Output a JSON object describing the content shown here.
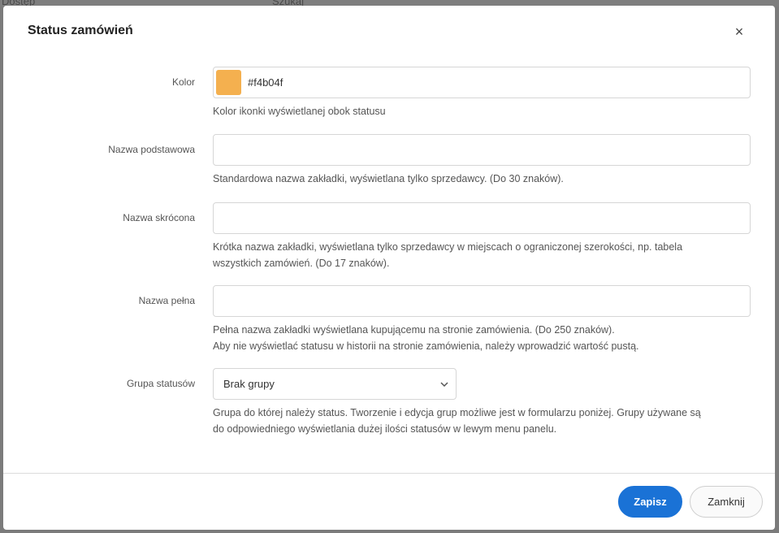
{
  "background": {
    "left_text": "Dostęp",
    "search_placeholder": "Szukaj"
  },
  "modal": {
    "title": "Status zamówień",
    "close_label": "×"
  },
  "form": {
    "color": {
      "label": "Kolor",
      "value": "#f4b04f",
      "swatch_color": "#f4b04f",
      "help": "Kolor ikonki wyświetlanej obok statusu"
    },
    "base_name": {
      "label": "Nazwa podstawowa",
      "value": "",
      "help": "Standardowa nazwa zakładki, wyświetlana tylko sprzedawcy. (Do 30 znaków)."
    },
    "short_name": {
      "label": "Nazwa skrócona",
      "value": "",
      "help_line1": "Krótka nazwa zakładki, wyświetlana tylko sprzedawcy w miejscach o ograniczonej szerokości, np. tabela",
      "help_line2": "wszystkich zamówień. (Do 17 znaków)."
    },
    "full_name": {
      "label": "Nazwa pełna",
      "value": "",
      "help_line1": "Pełna nazwa zakładki wyświetlana kupującemu na stronie zamówienia. (Do 250 znaków).",
      "help_line2": "Aby nie wyświetlać statusu w historii na stronie zamówienia, należy wprowadzić wartość pustą."
    },
    "status_group": {
      "label": "Grupa statusów",
      "selected": "Brak grupy",
      "help_line1": "Grupa do której należy status. Tworzenie i edycja grup możliwe jest w formularzu poniżej. Grupy używane są",
      "help_line2": "do odpowiedniego wyświetlania dużej ilości statusów w lewym menu panelu."
    }
  },
  "footer": {
    "save_label": "Zapisz",
    "close_label": "Zamknij"
  },
  "colors": {
    "primary": "#1a72d6",
    "overlay": "#7b7b7b"
  }
}
